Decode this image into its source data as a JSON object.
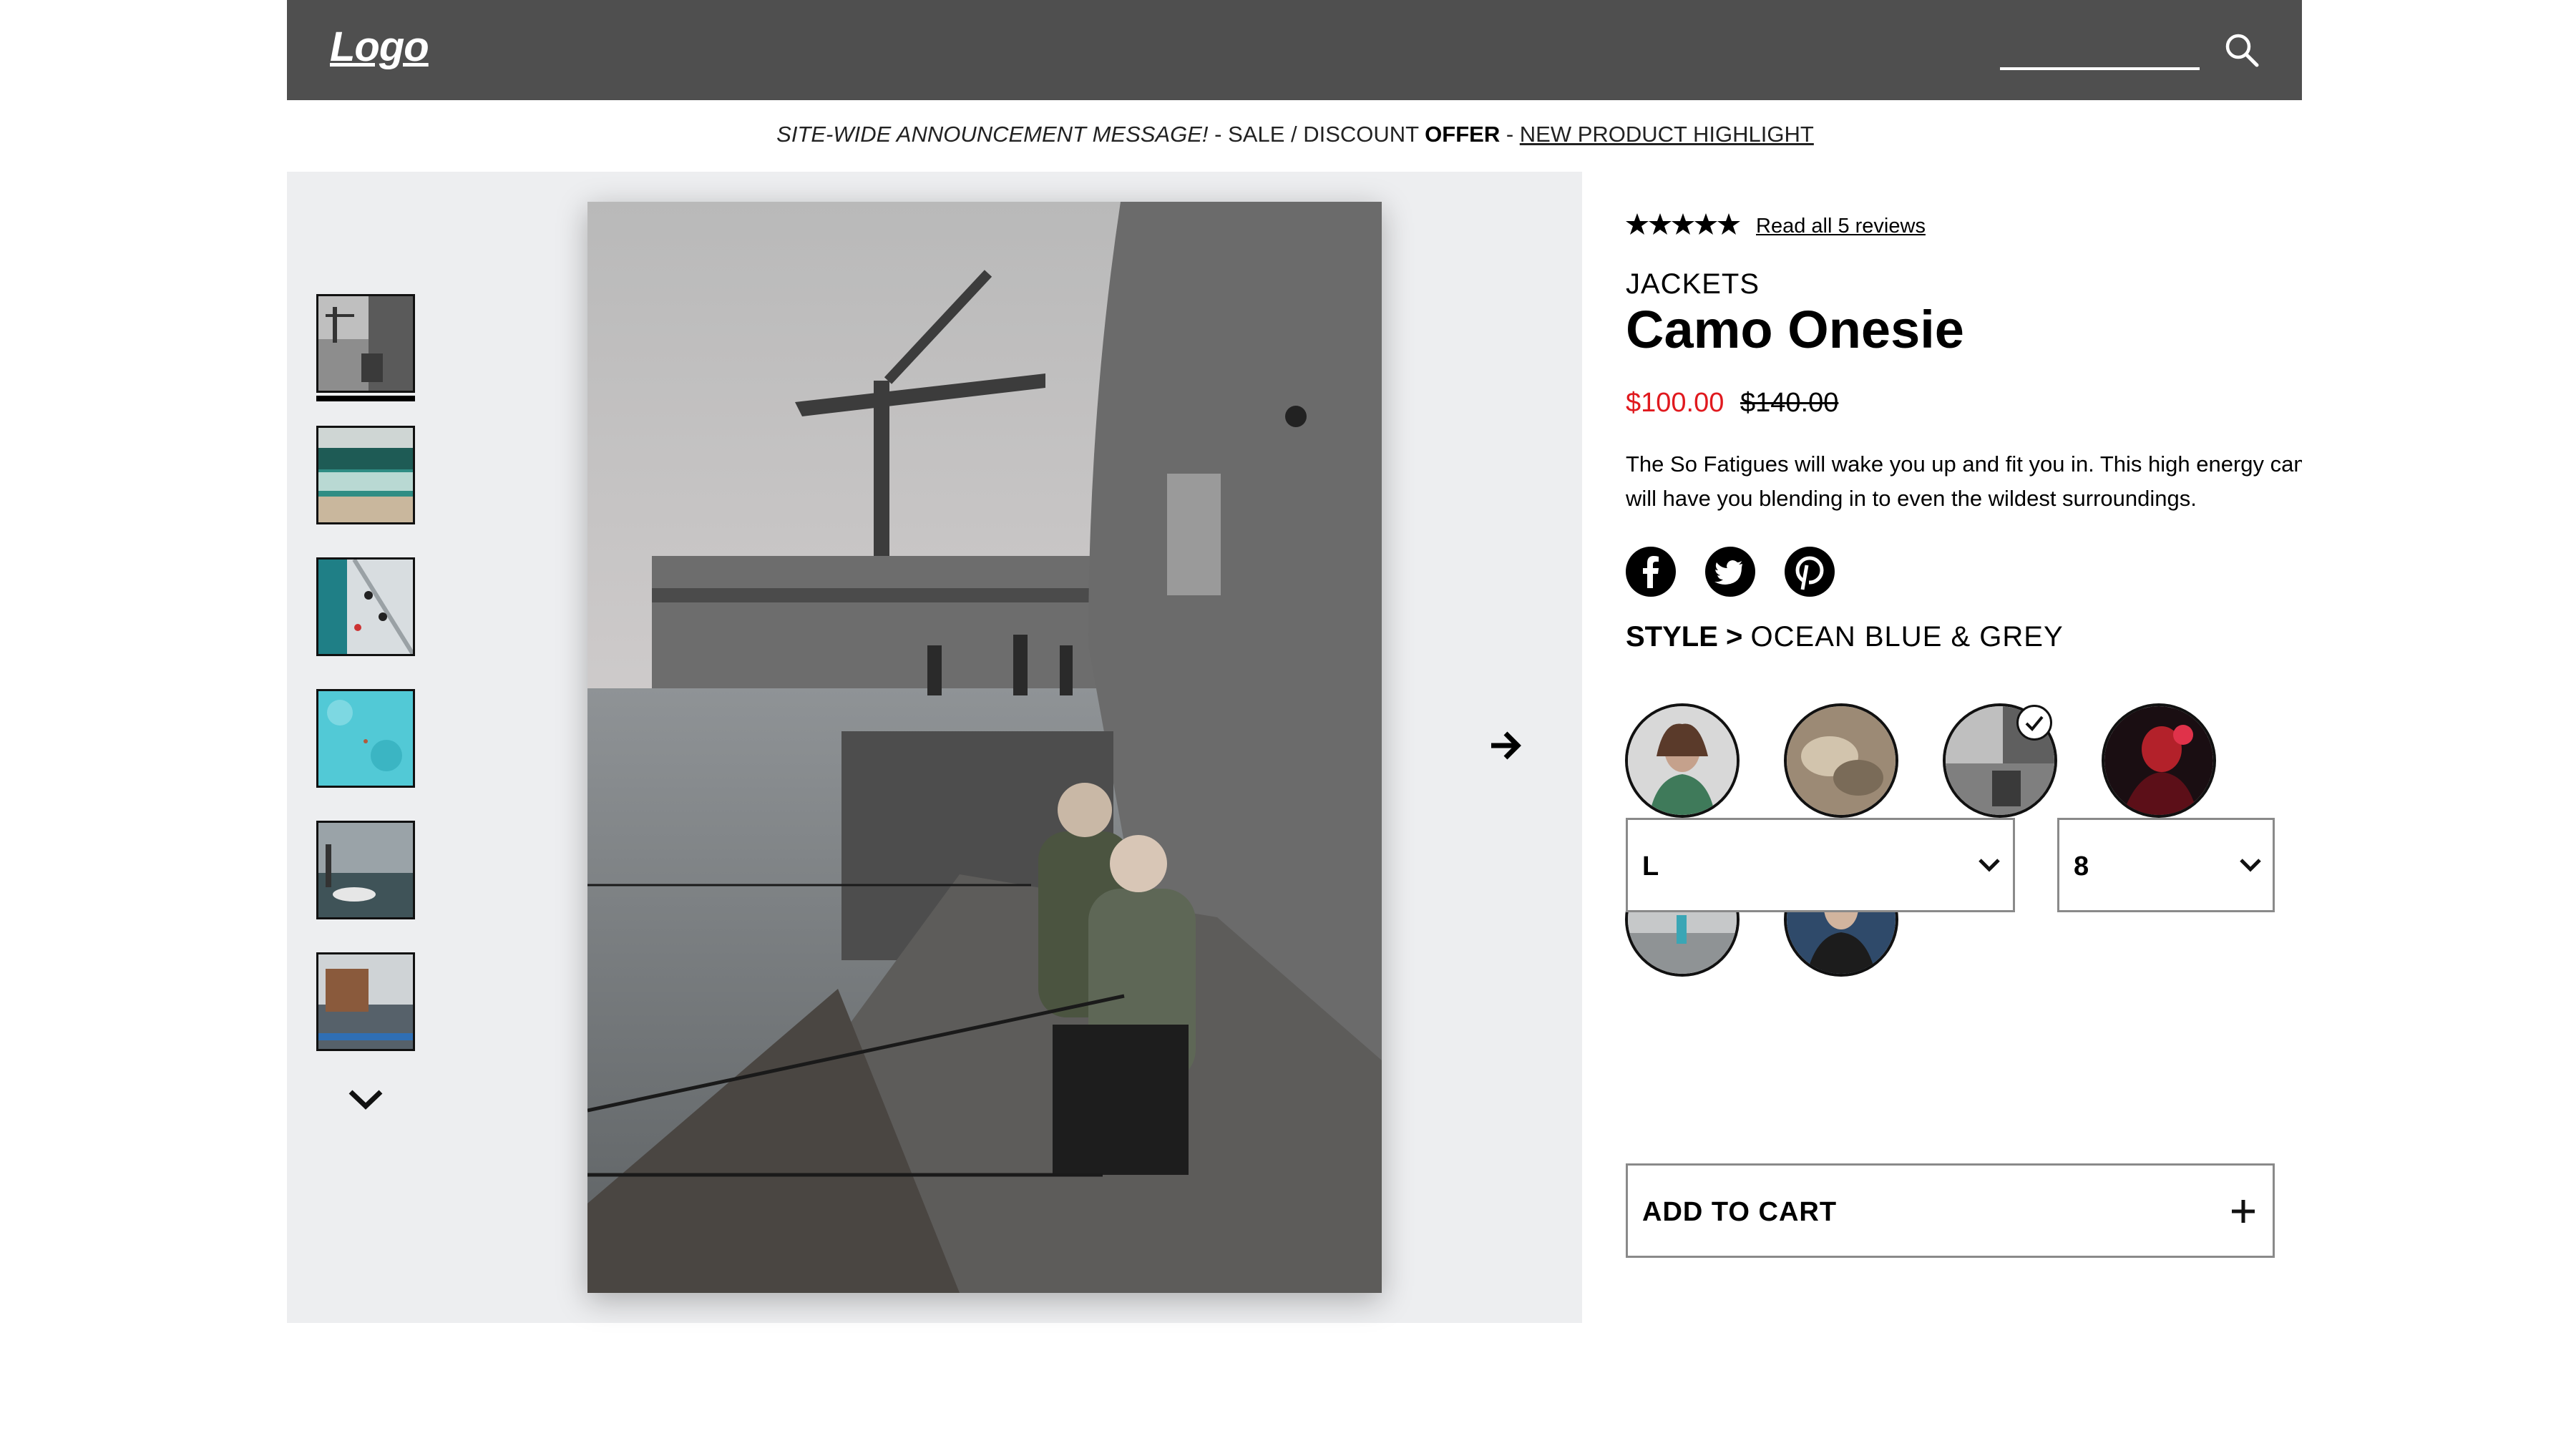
{
  "header": {
    "logo": "Logo",
    "search_placeholder": "",
    "icons": {
      "search": "search-icon"
    },
    "colors": {
      "background": "#4f4f4f",
      "text": "#ffffff"
    }
  },
  "announcement": {
    "part1": "SITE-WIDE ANNOUNCEMENT MESSAGE!",
    "part2": " - SALE / DISCOUNT ",
    "part3": "OFFER",
    "part4": " - ",
    "part5": "NEW PRODUCT HIGHLIGHT"
  },
  "gallery": {
    "thumbnails": [
      "thumb-1",
      "thumb-2",
      "thumb-3",
      "thumb-4",
      "thumb-5",
      "thumb-6"
    ],
    "selected_thumbnail": 1,
    "icons": {
      "scroll_down": "chevron-down-icon",
      "next": "arrow-right-icon"
    }
  },
  "product": {
    "rating": 5,
    "reviews_link": "Read all 5 reviews",
    "category": "JACKETS",
    "title": "Camo Onesie",
    "sale_price": "$100.00",
    "original_price": "$140.00",
    "description_line1": "The So Fatigues will wake you up and fit you in. This high energy camo",
    "description_line2": "will have you blending in to even the wildest surroundings.",
    "social": [
      "facebook-icon",
      "twitter-icon",
      "pinterest-icon"
    ],
    "style_label": "STYLE >",
    "style_value": "OCEAN BLUE & GREY",
    "swatches": [
      "swatch-1",
      "swatch-2",
      "swatch-3",
      "swatch-4",
      "swatch-5",
      "swatch-6"
    ],
    "selected_swatch": 3,
    "size_value": "L",
    "quantity_value": "8",
    "add_to_cart": "ADD TO CART",
    "colors": {
      "sale_price": "#e0191e",
      "gallery_bg": "#edeef0"
    }
  }
}
